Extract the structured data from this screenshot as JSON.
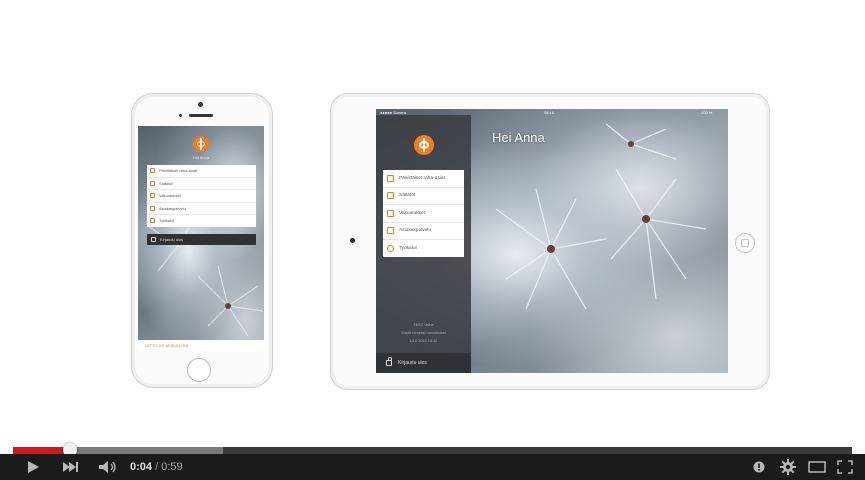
{
  "phone": {
    "greeting": "Hei Anna",
    "menu": [
      "Päivittäiset raha-asiat",
      "Säästöt",
      "Vakuutukset",
      "Asiakaspalvelu",
      "Työkalut"
    ],
    "logout_label": "Kirjaudu ulos",
    "banner": "LIITTO OP-MOBIILISSA"
  },
  "tablet": {
    "status": {
      "carrier": "●●●●● Sonera",
      "time": "08:16",
      "battery": "100 %"
    },
    "greeting": "Hei Anna",
    "menu": [
      "Päivittäiset raha-asiat",
      "Säästöt",
      "Vakuutukset",
      "Asiakaspalvelu",
      "Työkalut"
    ],
    "footer": [
      "TEST Vaihe",
      "Käytit viimeksi tunnuksiasi",
      "13.2.2015 13:12"
    ],
    "logout_label": "Kirjaudu ulos"
  },
  "player": {
    "current_time": "0:04",
    "separator": " / ",
    "duration": "0:59",
    "played_fraction": 0.068,
    "buffered_fraction": 0.25,
    "icons": [
      "play-icon",
      "next-icon",
      "volume-icon",
      "annotations-icon",
      "settings-gear-icon",
      "theater-mode-icon",
      "fullscreen-icon"
    ]
  },
  "colors": {
    "accent": "#f47b20",
    "progress_played": "#cc181e",
    "control_bar": "#1b1b1b"
  }
}
